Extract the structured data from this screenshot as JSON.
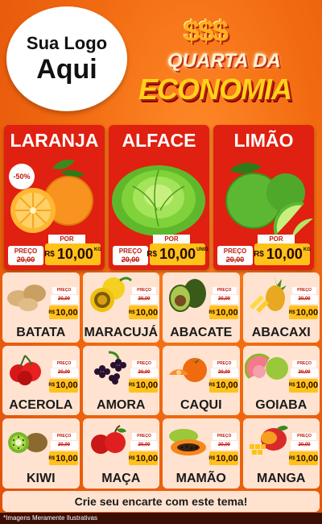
{
  "logo": {
    "line1": "Sua Logo",
    "line2": "Aqui"
  },
  "headline": {
    "symbols": "$$$",
    "line1": "QUARTA DA",
    "line2": "ECONOMIA"
  },
  "colors": {
    "background": "#f26a10",
    "card_red": "#e02010",
    "price_yellow": "#ffc21a",
    "cell_bg": "#ffe3d0"
  },
  "featured": [
    {
      "name": "LARANJA",
      "icon": "orange-icon",
      "discount": "-50%",
      "por": "POR",
      "old_label": "PREÇO",
      "old": "20,00",
      "rs": "R$",
      "price": "10,00",
      "unit": "KG"
    },
    {
      "name": "ALFACE",
      "icon": "lettuce-icon",
      "por": "POR",
      "old_label": "PREÇO",
      "old": "20,00",
      "rs": "R$",
      "price": "10,00",
      "unit": "UNID"
    },
    {
      "name": "LIMÃO",
      "icon": "lime-icon",
      "por": "POR",
      "old_label": "PREÇO",
      "old": "20,00",
      "rs": "R$",
      "price": "10,00",
      "unit": "KG"
    }
  ],
  "products": [
    {
      "name": "BATATA",
      "icon": "potato-icon",
      "por": "PREÇO",
      "old": "20,00",
      "rs": "R$",
      "price": "10,00"
    },
    {
      "name": "MARACUJÁ",
      "icon": "passion-fruit-icon",
      "por": "PREÇO",
      "old": "20,00",
      "rs": "R$",
      "price": "10,00"
    },
    {
      "name": "ABACATE",
      "icon": "avocado-icon",
      "por": "PREÇO",
      "old": "20,00",
      "rs": "R$",
      "price": "10,00"
    },
    {
      "name": "ABACAXI",
      "icon": "pineapple-icon",
      "por": "PREÇO",
      "old": "20,00",
      "rs": "R$",
      "price": "10,00"
    },
    {
      "name": "ACEROLA",
      "icon": "acerola-icon",
      "por": "PREÇO",
      "old": "20,00",
      "rs": "R$",
      "price": "10,00"
    },
    {
      "name": "AMORA",
      "icon": "blackberry-icon",
      "por": "PREÇO",
      "old": "20,00",
      "rs": "R$",
      "price": "10,00"
    },
    {
      "name": "CAQUI",
      "icon": "persimmon-icon",
      "por": "PREÇO",
      "old": "20,00",
      "rs": "R$",
      "price": "10,00"
    },
    {
      "name": "GOIABA",
      "icon": "guava-icon",
      "por": "PREÇO",
      "old": "20,00",
      "rs": "R$",
      "price": "10,00"
    },
    {
      "name": "KIWI",
      "icon": "kiwi-icon",
      "por": "PREÇO",
      "old": "20,00",
      "rs": "R$",
      "price": "10,00"
    },
    {
      "name": "MAÇA",
      "icon": "apple-icon",
      "por": "PREÇO",
      "old": "20,00",
      "rs": "R$",
      "price": "10,00"
    },
    {
      "name": "MAMÃO",
      "icon": "papaya-icon",
      "por": "PREÇO",
      "old": "20,00",
      "rs": "R$",
      "price": "10,00"
    },
    {
      "name": "MANGA",
      "icon": "mango-icon",
      "por": "PREÇO",
      "old": "20,00",
      "rs": "R$",
      "price": "10,00"
    }
  ],
  "cta": "Crie seu encarte com este tema!",
  "footer": "*Imagens Meramente Ilustrativas"
}
